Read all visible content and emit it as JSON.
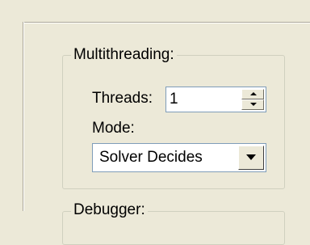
{
  "multithreading": {
    "legend": "Multithreading:",
    "threads_label": "Threads:",
    "threads_value": "1",
    "mode_label": "Mode:",
    "mode_value": "Solver Decides"
  },
  "debugger": {
    "legend": "Debugger:"
  },
  "icons": {
    "spin_up": "triangle-up-icon",
    "spin_down": "triangle-down-icon",
    "dropdown": "triangle-down-icon"
  },
  "colors": {
    "dialog_background": "#ece9d8",
    "groupbox_border": "#d0d0bf",
    "input_border": "#7f9db9"
  }
}
